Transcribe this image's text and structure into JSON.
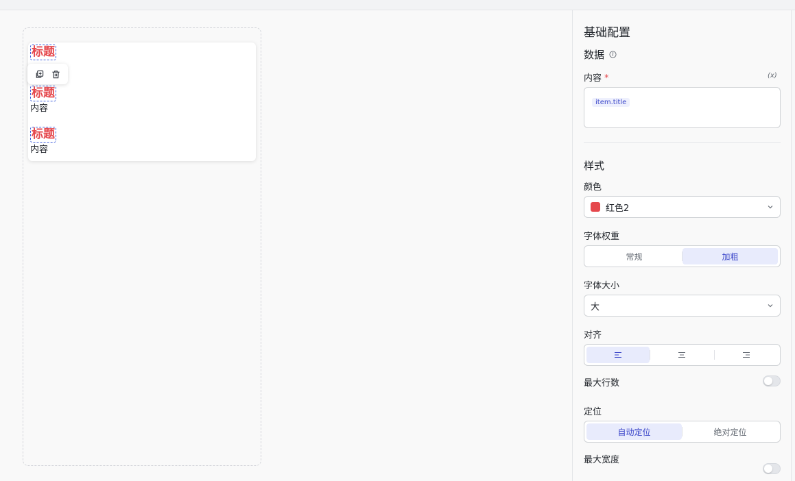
{
  "canvas": {
    "list_items": [
      {
        "title": "标题",
        "content": ""
      },
      {
        "title": "标题",
        "content": "内容"
      },
      {
        "title": "标题",
        "content": "内容"
      }
    ],
    "toolbar": {
      "copy_icon": "copy-icon",
      "delete_icon": "trash-icon"
    }
  },
  "panel": {
    "basic_config": "基础配置",
    "data_section": "数据",
    "data_info_icon": "info-icon",
    "content_label": "内容",
    "required_mark": "*",
    "fx_label": "(x)",
    "content_tag": "item.title",
    "style_section": "样式",
    "color_label": "颜色",
    "color_value": "红色2",
    "color_swatch": "#e5484d",
    "font_weight_label": "字体权重",
    "font_weight_options": [
      "常规",
      "加粗"
    ],
    "font_weight_selected": "加粗",
    "font_size_label": "字体大小",
    "font_size_value": "大",
    "align_label": "对齐",
    "align_options": [
      "align-left-icon",
      "align-center-icon",
      "align-right-icon"
    ],
    "max_lines_label": "最大行数",
    "max_lines_enabled": false,
    "position_label": "定位",
    "position_options": [
      "自动定位",
      "绝对定位"
    ],
    "position_selected": "自动定位",
    "max_width_label": "最大宽度",
    "max_width_enabled": false
  },
  "colors": {
    "accent": "#3b46c9",
    "accent_bg": "#e8ebfc",
    "title_red": "#e5484d"
  }
}
